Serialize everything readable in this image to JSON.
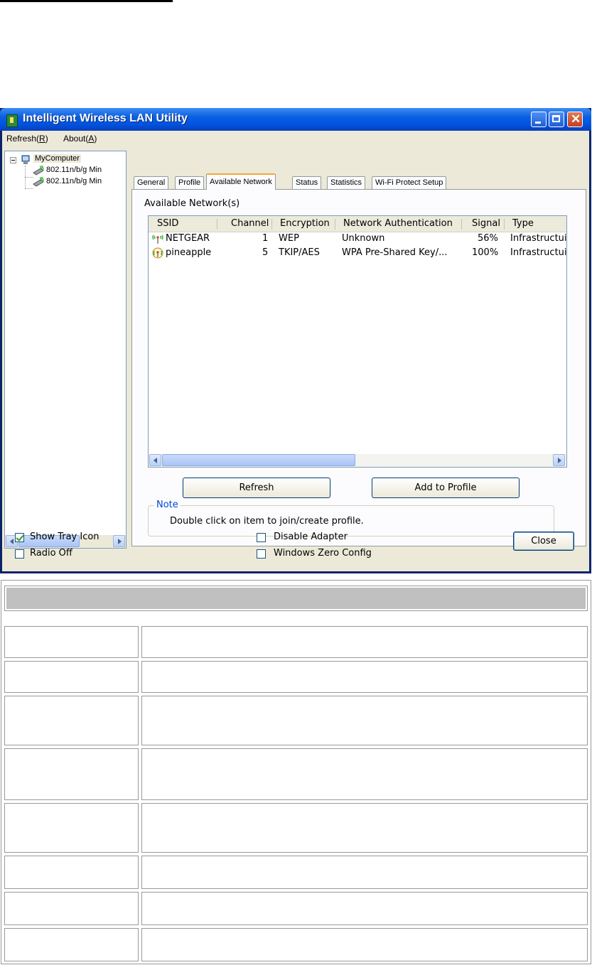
{
  "window": {
    "title": "Intelligent Wireless LAN Utility"
  },
  "menu": {
    "refresh_label": "Refresh(",
    "refresh_key": "R",
    "about_label": "About(",
    "about_key": "A",
    "close_paren": ")"
  },
  "tree": {
    "root": "MyComputer",
    "adapters": [
      "802.11n/b/g Min",
      "802.11n/b/g Min"
    ]
  },
  "tabs": [
    "General",
    "Profile",
    "Available Network",
    "Status",
    "Statistics",
    "Wi-Fi Protect Setup"
  ],
  "active_tab": "Available Network",
  "available": {
    "heading": "Available Network(s)",
    "columns": [
      "SSID",
      "Channel",
      "Encryption",
      "Network Authentication",
      "Signal",
      "Type"
    ],
    "rows": [
      {
        "ssid": "NETGEAR",
        "channel": "1",
        "encryption": "WEP",
        "auth": "Unknown",
        "signal": "56%",
        "type": "Infrastructui"
      },
      {
        "ssid": "pineapple",
        "channel": "5",
        "encryption": "TKIP/AES",
        "auth": "WPA Pre-Shared Key/...",
        "signal": "100%",
        "type": "Infrastructui"
      }
    ],
    "refresh_button": "Refresh",
    "add_profile_button": "Add to Profile",
    "note_title": "Note",
    "note_text": "Double click on item to join/create profile."
  },
  "footer": {
    "show_tray_icon": "Show Tray Icon",
    "show_tray_icon_checked": true,
    "radio_off": "Radio Off",
    "radio_off_checked": false,
    "disable_adapter": "Disable Adapter",
    "disable_adapter_checked": false,
    "windows_zero_config": "Windows Zero Config",
    "windows_zero_config_checked": false,
    "close_button": "Close"
  },
  "colors": {
    "title_bar": "#0054e3",
    "active_tab_accent": "#f7a637",
    "note_legend": "#0046d5",
    "table_header": "#c0c0c0"
  }
}
